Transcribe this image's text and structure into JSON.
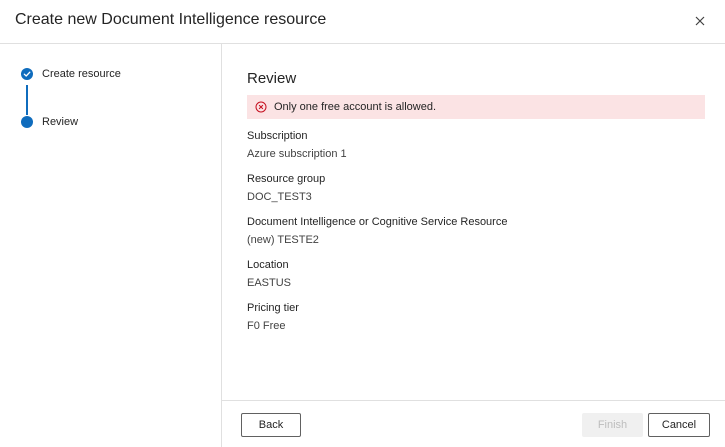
{
  "dialog": {
    "title": "Create new Document Intelligence resource",
    "close_icon": "close-icon"
  },
  "steps": [
    {
      "label": "Create resource",
      "status": "completed",
      "icon": "checkmark-icon"
    },
    {
      "label": "Review",
      "status": "current"
    }
  ],
  "review": {
    "title": "Review",
    "error": {
      "message": "Only one free account is allowed.",
      "icon": "error-circle-icon",
      "background": "#fbe3e4",
      "icon_color": "#c50f1f"
    },
    "fields": [
      {
        "label": "Subscription",
        "value": "Azure subscription 1"
      },
      {
        "label": "Resource group",
        "value": "DOC_TEST3"
      },
      {
        "label": "Document Intelligence or Cognitive Service Resource",
        "value": "(new) TESTE2"
      },
      {
        "label": "Location",
        "value": "EASTUS"
      },
      {
        "label": "Pricing tier",
        "value": "F0 Free"
      }
    ]
  },
  "footer": {
    "back_label": "Back",
    "finish_label": "Finish",
    "cancel_label": "Cancel",
    "finish_disabled": true
  },
  "colors": {
    "accent": "#0f6cbd",
    "divider": "#e0e0e0"
  }
}
